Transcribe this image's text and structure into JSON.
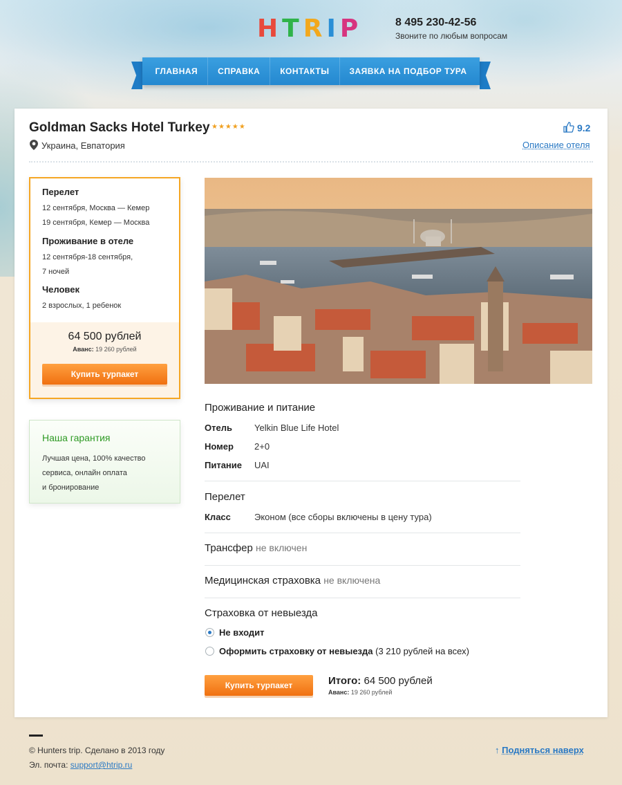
{
  "header": {
    "logo_letters": [
      {
        "char": "H",
        "color": "#e84a3c"
      },
      {
        "char": "T",
        "color": "#2fb34a"
      },
      {
        "char": "R",
        "color": "#f2a81d"
      },
      {
        "char": "I",
        "color": "#2a8fd6"
      },
      {
        "char": "P",
        "color": "#d7347f"
      }
    ],
    "phone": "8 495 230-42-56",
    "phone_subtitle": "Звоните по любым вопросам"
  },
  "nav": {
    "items": [
      "ГЛАВНАЯ",
      "СПРАВКА",
      "КОНТАКТЫ",
      "ЗАЯВКА НА ПОДБОР ТУРА"
    ]
  },
  "hotel": {
    "name": "Goldman Sacks Hotel Turkey",
    "stars": "★★★★★",
    "star_count": 5,
    "location": "Украина, Евпатория",
    "rating": "9.2",
    "description_link": "Описание отеля"
  },
  "summary": {
    "flight_title": "Перелет",
    "flight_lines": [
      "12 сентября, Москва — Кемер",
      "19 сентября, Кемер — Москва"
    ],
    "stay_title": "Проживание в отеле",
    "stay_lines": [
      "12 сентября-18 сентября,",
      "7 ночей"
    ],
    "people_title": "Человек",
    "people_line": "2 взрослых, 1 ребенок",
    "price": "64 500 рублей",
    "avans_label": "Аванс:",
    "avans_value": "19 260 рублей",
    "buy_label": "Купить турпакет"
  },
  "guarantee": {
    "title": "Наша гарантия",
    "lines": [
      "Лучшая цена, 100% качество",
      "сервиса, онлайн оплата",
      "и бронирование"
    ]
  },
  "details": {
    "accommodation_title": "Проживание и питание",
    "rows": [
      {
        "label": "Отель",
        "value": "Yelkin Blue Life Hotel"
      },
      {
        "label": "Номер",
        "value": "2+0"
      },
      {
        "label": "Питание",
        "value": "UAI"
      }
    ],
    "flight_title": "Перелет",
    "class_label": "Класс",
    "class_value": "Эконом (все сборы включены в цену тура)",
    "transfer_title": "Трансфер",
    "transfer_status": "не включен",
    "medical_title": "Медицинская страховка",
    "medical_status": "не включена",
    "cancel_title": "Страховка от невыезда",
    "option_no": "Не входит",
    "option_yes": "Оформить страховку от невыезда",
    "option_yes_price": "(3 210 рублей на всех)",
    "selected_option": "Не входит",
    "buy_label": "Купить турпакет",
    "total_label": "Итого:",
    "total_value": "64 500 рублей",
    "avans_label": "Аванс:",
    "avans_value": "19 260 рублей"
  },
  "footer": {
    "copyright": "© Hunters trip. Сделано в 2013 году",
    "mail_label": "Эл. почта:",
    "mail": "support@htrip.ru",
    "up_arrow": "↑",
    "up_label": "Подняться наверх"
  },
  "colors": {
    "accent_blue": "#2a79c4",
    "nav_blue": "#2488d0",
    "orange": "#f5a623",
    "green": "#2e9a24"
  }
}
